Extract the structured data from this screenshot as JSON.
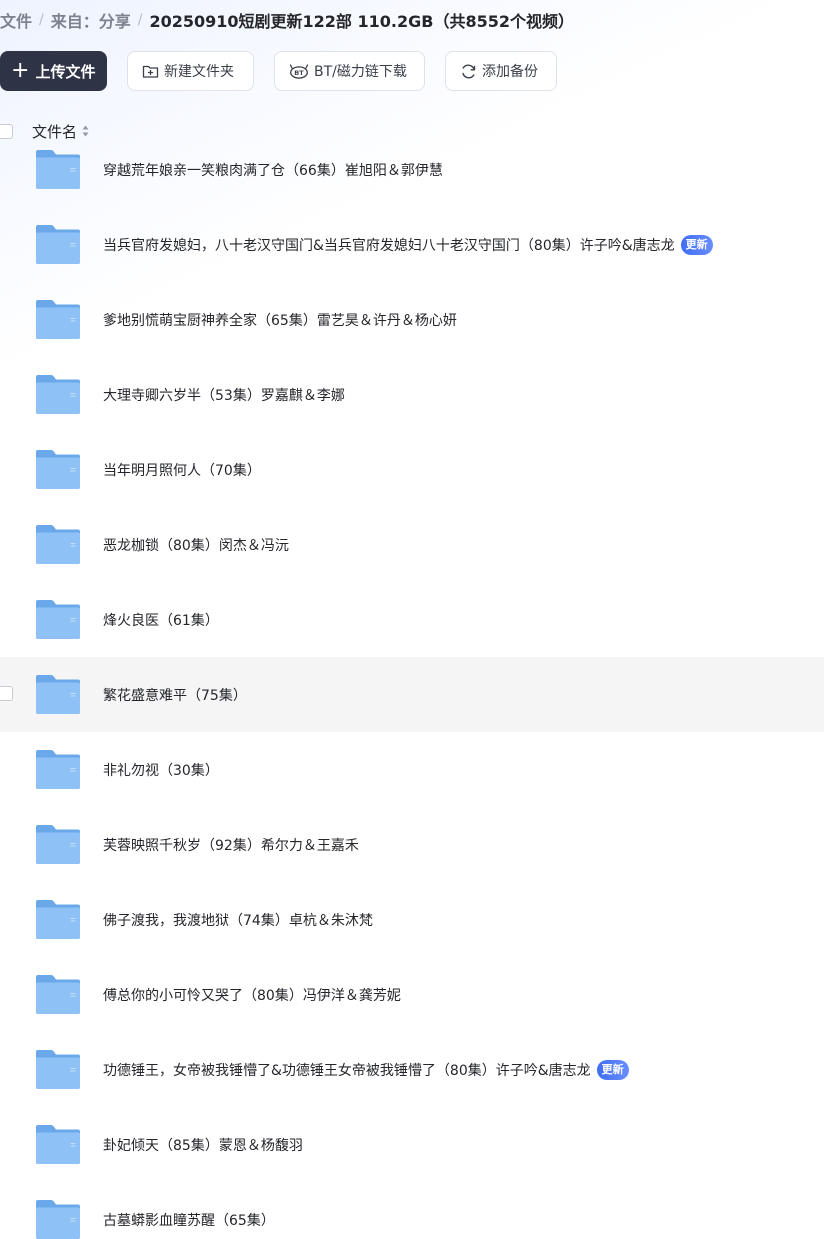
{
  "breadcrumb": {
    "items": [
      "文件",
      "来自：分享"
    ],
    "current": "20250910短剧更新122部 110.2GB（共8552个视频）"
  },
  "toolbar": {
    "upload_label": "上传文件",
    "new_folder_label": "新建文件夹",
    "bt_label": "BT/磁力链下载",
    "backup_label": "添加备份"
  },
  "table": {
    "column_name": "文件名"
  },
  "files": [
    {
      "name": "穿越荒年娘亲一笑粮肉满了仓（66集）崔旭阳＆郭伊慧",
      "badge": ""
    },
    {
      "name": "当兵官府发媳妇，八十老汉守国门&当兵官府发媳妇八十老汉守国门（80集）许子吟&唐志龙",
      "badge": "更新"
    },
    {
      "name": "爹地别慌萌宝厨神养全家（65集）雷艺昊＆许丹＆杨心妍",
      "badge": ""
    },
    {
      "name": "大理寺卿六岁半（53集）罗嘉麒＆李娜",
      "badge": ""
    },
    {
      "name": "当年明月照何人（70集）",
      "badge": ""
    },
    {
      "name": "恶龙枷锁（80集）闵杰＆冯沅",
      "badge": ""
    },
    {
      "name": "烽火良医（61集）",
      "badge": ""
    },
    {
      "name": "繁花盛意难平（75集）",
      "badge": ""
    },
    {
      "name": "非礼勿视（30集）",
      "badge": ""
    },
    {
      "name": "芙蓉映照千秋岁（92集）希尔力＆王嘉禾",
      "badge": ""
    },
    {
      "name": "佛子渡我，我渡地狱（74集）卓杭＆朱沐梵",
      "badge": ""
    },
    {
      "name": "傅总你的小可怜又哭了（80集）冯伊洋＆龚芳妮",
      "badge": ""
    },
    {
      "name": "功德锤王，女帝被我锤懵了&功德锤王女帝被我锤懵了（80集）许子吟&唐志龙",
      "badge": "更新"
    },
    {
      "name": "卦妃倾天（85集）蒙恩＆杨馥羽",
      "badge": ""
    },
    {
      "name": "古墓蟒影血瞳苏醒（65集）",
      "badge": ""
    }
  ]
}
